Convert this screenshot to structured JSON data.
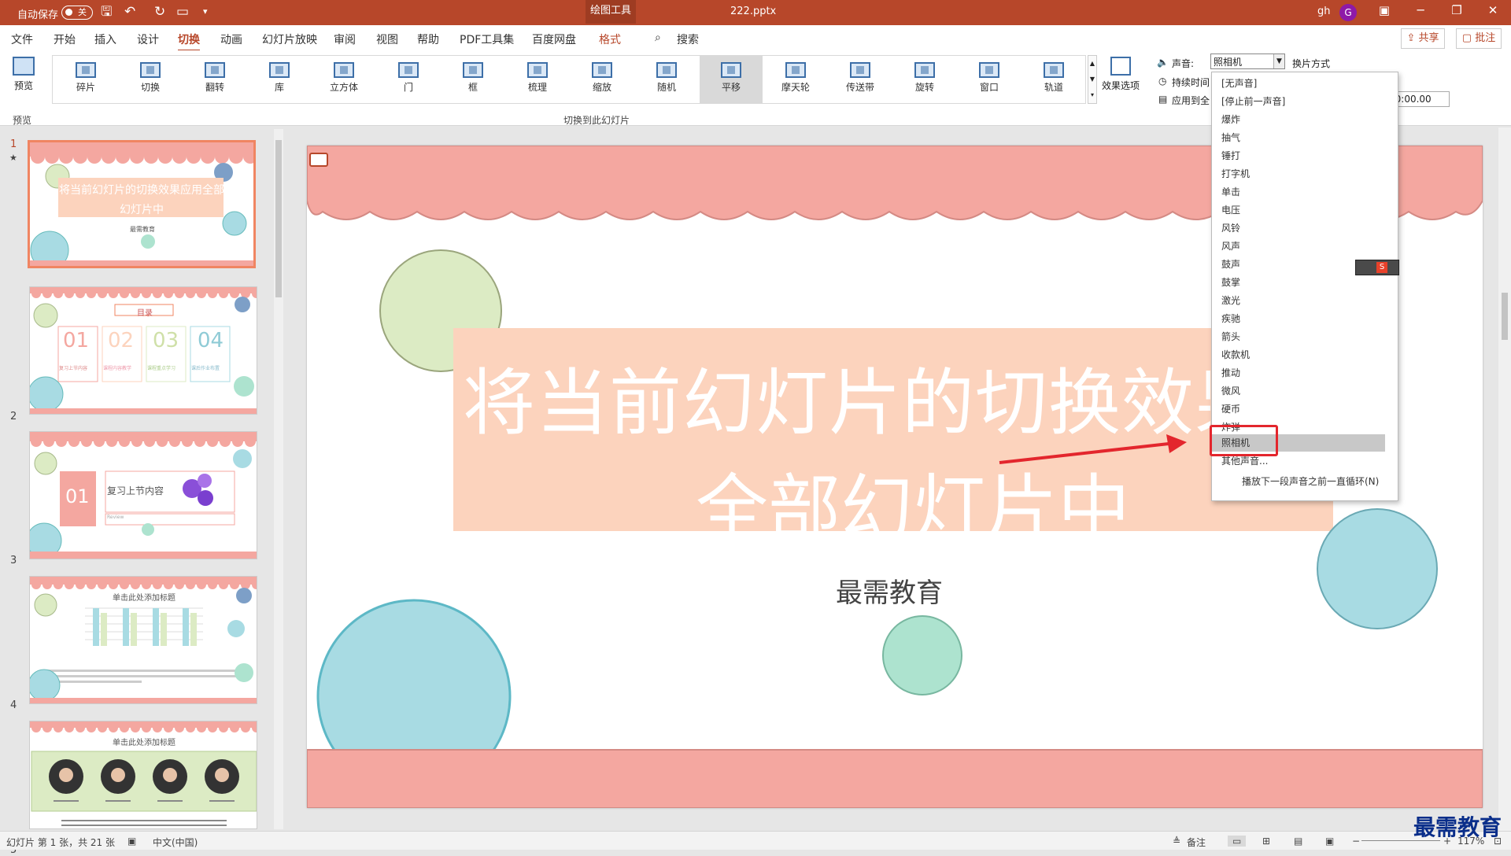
{
  "title_bar": {
    "autosave_label": "自动保存",
    "autosave_state": "关",
    "contextual_tab": "绘图工具",
    "document_title": "222.pptx",
    "user": "gh",
    "avatar_initial": "G"
  },
  "menu": {
    "items": [
      "文件",
      "开始",
      "插入",
      "设计",
      "切换",
      "动画",
      "幻灯片放映",
      "审阅",
      "视图",
      "帮助",
      "PDF工具集",
      "百度网盘",
      "格式"
    ],
    "active": "切换",
    "search_label": "搜索",
    "share_label": "共享",
    "comment_label": "批注"
  },
  "ribbon": {
    "preview_label": "预览",
    "preview_group": "预览",
    "transitions_group": "切换到此幻灯片",
    "transitions": [
      "碎片",
      "切换",
      "翻转",
      "库",
      "立方体",
      "门",
      "框",
      "梳理",
      "缩放",
      "随机",
      "平移",
      "摩天轮",
      "传送带",
      "旋转",
      "窗口",
      "轨道"
    ],
    "selected_transition": "平移",
    "effect_options_label": "效果选项",
    "sound_label": "声音:",
    "sound_value": "照相机",
    "switch_mode_label": "换片方式",
    "duration_label": "持续时间",
    "apply_all_label": "应用到全",
    "duration_value": "00:00.00"
  },
  "sound_dropdown": {
    "items": [
      "[无声音]",
      "[停止前一声音]",
      "爆炸",
      "抽气",
      "锤打",
      "打字机",
      "单击",
      "电压",
      "风铃",
      "风声",
      "鼓声",
      "鼓掌",
      "激光",
      "疾驰",
      "箭头",
      "收款机",
      "推动",
      "微风",
      "硬币",
      "炸弹",
      "照相机",
      "其他声音..."
    ],
    "selected": "照相机",
    "loop_label": "播放下一段声音之前一直循环(N)"
  },
  "thumbnails": {
    "numbers": [
      "1",
      "2",
      "3",
      "4",
      "5"
    ],
    "t1_title": "将当前幻灯片的切换效果应用全部幻灯片中",
    "t1_sub": "最需教育",
    "t2_title": "目录",
    "t2_nums": [
      "01",
      "02",
      "03",
      "04"
    ],
    "t2_labels": [
      "复习上节内容",
      "课程内容教学",
      "课程重点学习",
      "课后作业布置"
    ],
    "t3_num": "01",
    "t3_title": "复习上节内容",
    "t3_sub": "Review",
    "t4_title": "单击此处添加标题",
    "t5_title": "单击此处添加标题"
  },
  "slide": {
    "title_line1": "将当前幻灯片的切换效果应",
    "title_line2": "全部幻灯片中",
    "subtitle": "最需教育"
  },
  "status": {
    "slide_info": "幻灯片 第 1 张，共 21 张",
    "language": "中文(中国)",
    "notes_label": "备注",
    "zoom": "117%"
  },
  "watermark": "最需教育",
  "colors": {
    "accent": "#b7472a",
    "scallop": "#f4a7a0",
    "banner": "#fcd3bd",
    "circle_blue": "#a8dbe3",
    "circle_green": "#dcebc4",
    "circle_teal": "#ade3cf",
    "highlight_box": "#e3262d",
    "arrow": "#e3262d"
  }
}
